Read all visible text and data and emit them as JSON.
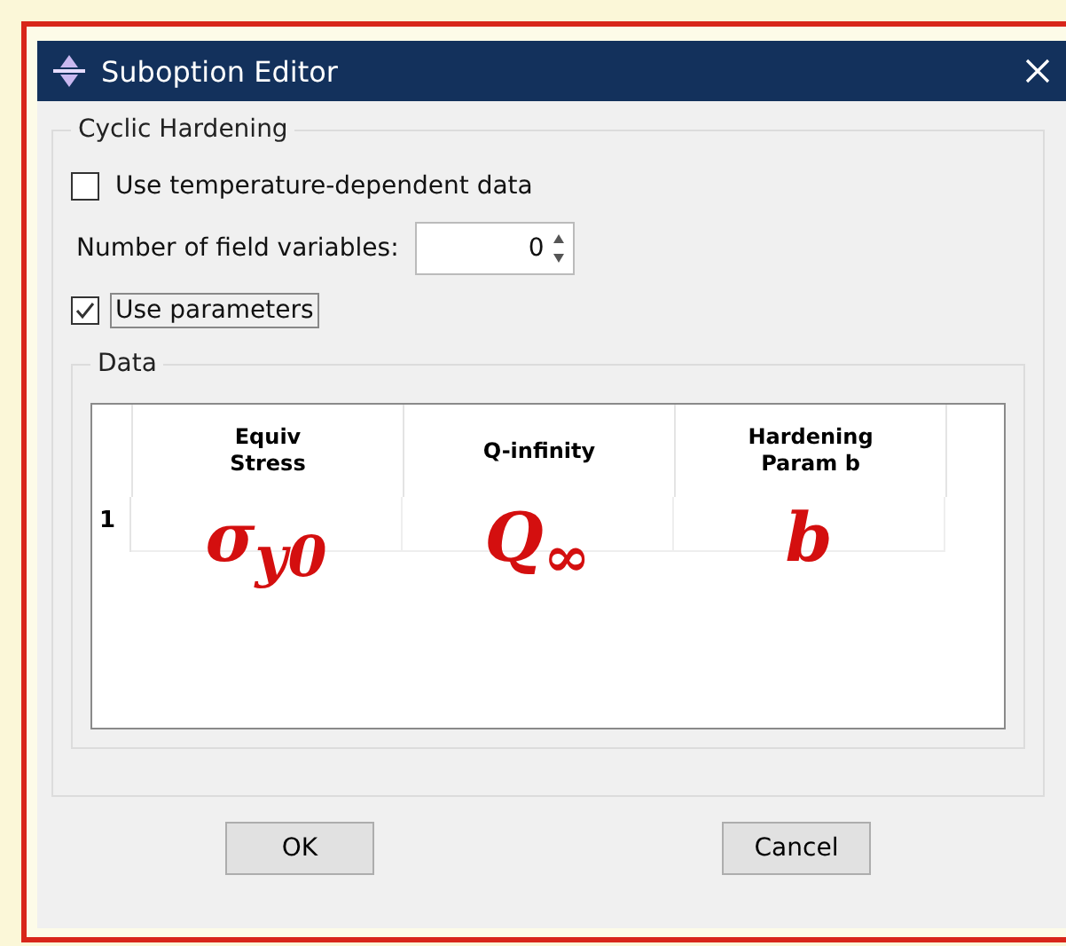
{
  "window": {
    "title": "Suboption Editor"
  },
  "group": {
    "title": "Cyclic Hardening"
  },
  "options": [
    {
      "kind": "checkbox",
      "label": "Use temperature-dependent data",
      "checked": false
    },
    {
      "kind": "spinner",
      "label": "Number of field variables:",
      "value": "0"
    },
    {
      "kind": "checkbox",
      "label": "Use parameters",
      "checked": true,
      "focused": true
    }
  ],
  "data": {
    "title": "Data",
    "columns": [
      "Equiv\nStress",
      "Q-infinity",
      "Hardening\nParam b"
    ],
    "rows": [
      {
        "number": "1",
        "annotations": [
          "σ$_{y0}$",
          "Q$_{∞}$",
          "b"
        ]
      }
    ]
  },
  "buttons": [
    "OK",
    "Cancel"
  ]
}
